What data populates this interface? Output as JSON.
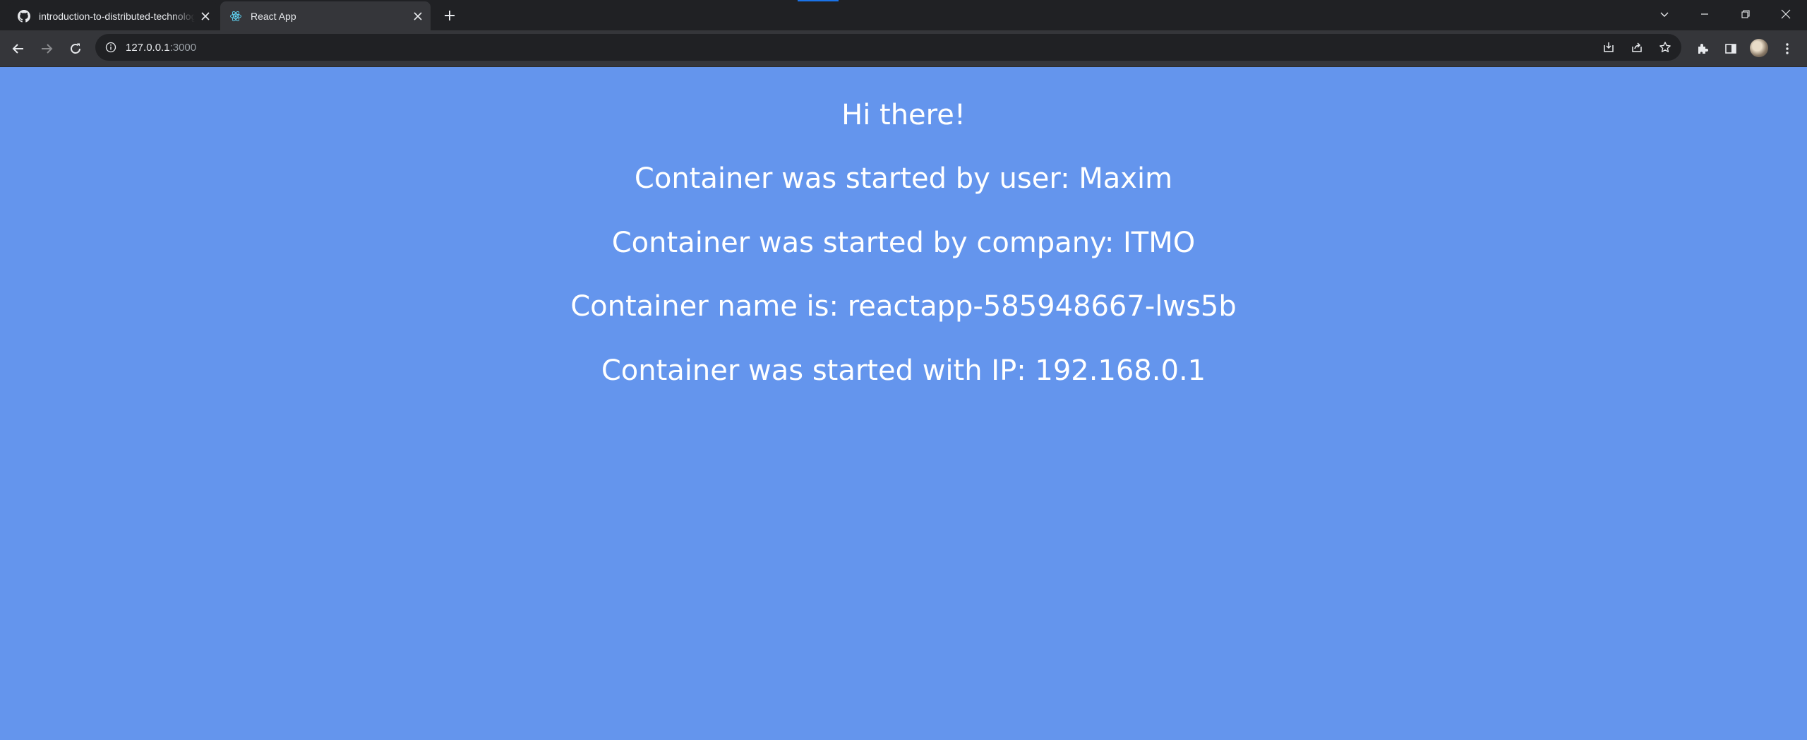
{
  "browser": {
    "tabs": [
      {
        "title": "introduction-to-distributed-technologies",
        "favicon": "github-icon",
        "active": false
      },
      {
        "title": "React App",
        "favicon": "react-icon",
        "active": true
      }
    ],
    "address_host": "127.0.0.1",
    "address_port": ":3000",
    "colors": {
      "frame": "#202124",
      "toolbar": "#35363a",
      "text": "#e8eaed"
    }
  },
  "page": {
    "background": "#6495ED",
    "greeting": "Hi there!",
    "user_line": "Container was started by user: Maxim",
    "company_line": "Container was started by company: ITMO",
    "name_line": "Container name is: reactapp-585948667-lws5b",
    "ip_line": "Container was started with IP: 192.168.0.1"
  }
}
